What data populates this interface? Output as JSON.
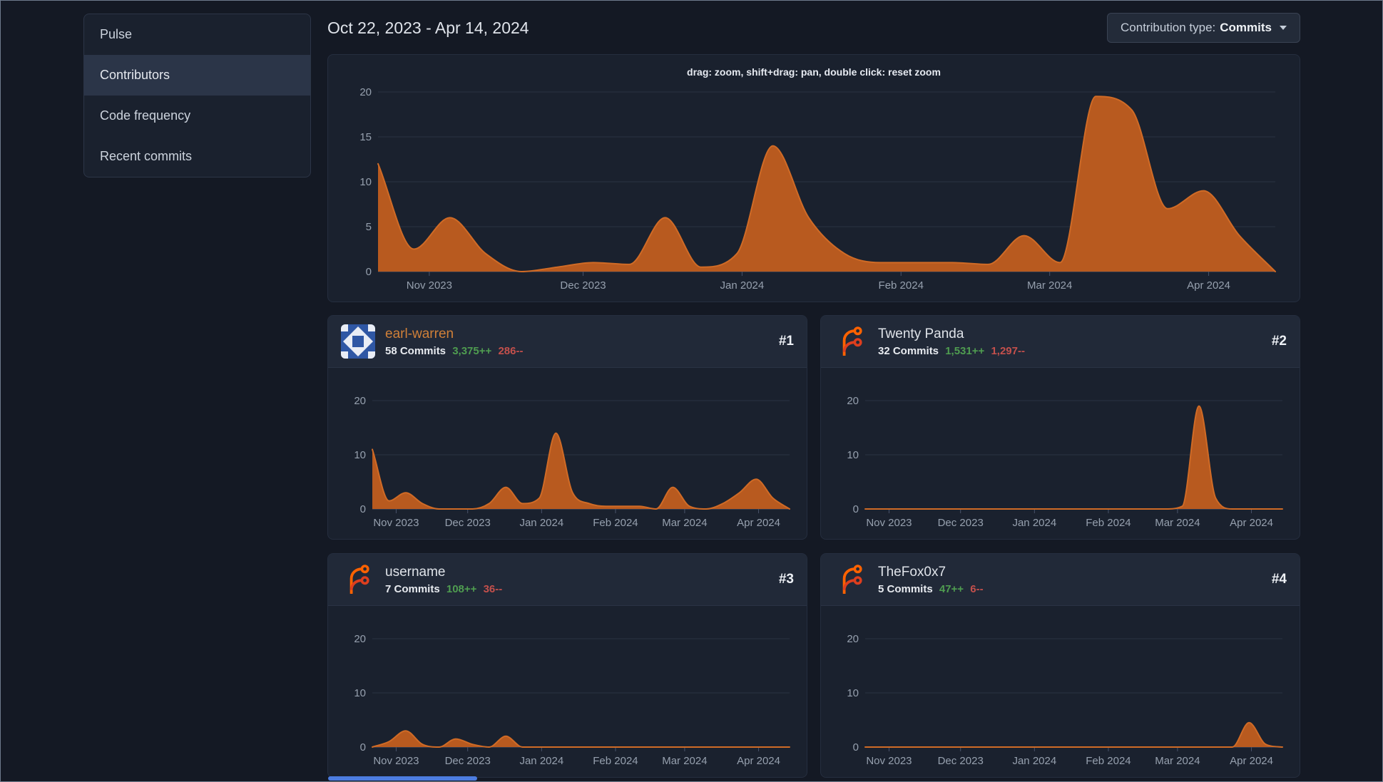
{
  "sidebar": {
    "items": [
      {
        "label": "Pulse",
        "active": false
      },
      {
        "label": "Contributors",
        "active": true
      },
      {
        "label": "Code frequency",
        "active": false
      },
      {
        "label": "Recent commits",
        "active": false
      }
    ]
  },
  "header": {
    "date_range": "Oct 22, 2023 - Apr 14, 2024",
    "contribution_type_label": "Contribution type:",
    "contribution_type_value": "Commits"
  },
  "contributors": [
    {
      "rank": "#1",
      "name": "earl-warren",
      "commits": "58 Commits",
      "additions": "3,375++",
      "deletions": "286--",
      "avatar": "identicon"
    },
    {
      "rank": "#2",
      "name": "Twenty Panda",
      "commits": "32 Commits",
      "additions": "1,531++",
      "deletions": "1,297--",
      "avatar": "forgejo-logo"
    },
    {
      "rank": "#3",
      "name": "username",
      "commits": "7 Commits",
      "additions": "108++",
      "deletions": "36--",
      "avatar": "forgejo-logo"
    },
    {
      "rank": "#4",
      "name": "TheFox0x7",
      "commits": "5 Commits",
      "additions": "47++",
      "deletions": "6--",
      "avatar": "forgejo-logo"
    }
  ],
  "chart_data": [
    {
      "id": "all-contributions",
      "type": "area",
      "size": "main",
      "hint": "drag: zoom, shift+drag: pan, double click: reset zoom",
      "x_range": [
        "Oct 22, 2023",
        "Apr 14, 2024"
      ],
      "interval": "weekly",
      "x_tick_labels": [
        "Nov 2023",
        "Dec 2023",
        "Jan 2024",
        "Feb 2024",
        "Mar 2024",
        "Apr 2024"
      ],
      "x_tick_day_offsets": [
        10,
        40,
        71,
        102,
        131,
        162
      ],
      "total_days": 175,
      "ylim": [
        0,
        20
      ],
      "y_ticks": [
        0,
        5,
        10,
        15,
        20
      ],
      "grid": true,
      "values": [
        12,
        2.5,
        6,
        2,
        0,
        0.5,
        1,
        0.8,
        6,
        0.5,
        2,
        14,
        6,
        2,
        1,
        1,
        1,
        0.8,
        4,
        1,
        19.5,
        18,
        7,
        9,
        4,
        0
      ]
    },
    {
      "id": "earl-warren-commits",
      "type": "area",
      "size": "small",
      "x_range": [
        "Oct 22, 2023",
        "Apr 14, 2024"
      ],
      "interval": "weekly",
      "x_tick_labels": [
        "Nov 2023",
        "Dec 2023",
        "Jan 2024",
        "Feb 2024",
        "Mar 2024",
        "Apr 2024"
      ],
      "x_tick_day_offsets": [
        10,
        40,
        71,
        102,
        131,
        162
      ],
      "total_days": 175,
      "ylim": [
        0,
        20
      ],
      "y_ticks": [
        0,
        10,
        20
      ],
      "grid": true,
      "values": [
        11,
        1.5,
        3,
        1,
        0,
        0,
        0,
        1,
        4,
        1,
        2,
        14,
        3,
        1,
        0.5,
        0.5,
        0.5,
        0,
        4,
        0.5,
        0,
        1,
        3,
        5.5,
        2,
        0
      ]
    },
    {
      "id": "twenty-panda-commits",
      "type": "area",
      "size": "small",
      "x_range": [
        "Oct 22, 2023",
        "Apr 14, 2024"
      ],
      "interval": "weekly",
      "x_tick_labels": [
        "Nov 2023",
        "Dec 2023",
        "Jan 2024",
        "Feb 2024",
        "Mar 2024",
        "Apr 2024"
      ],
      "x_tick_day_offsets": [
        10,
        40,
        71,
        102,
        131,
        162
      ],
      "total_days": 175,
      "ylim": [
        0,
        20
      ],
      "y_ticks": [
        0,
        10,
        20
      ],
      "grid": true,
      "values": [
        0,
        0,
        0,
        0,
        0,
        0,
        0,
        0,
        0,
        0,
        0,
        0,
        0,
        0,
        0,
        0,
        0,
        0,
        0,
        0.5,
        19,
        2,
        0,
        0,
        0,
        0
      ]
    },
    {
      "id": "username-commits",
      "type": "area",
      "size": "small",
      "x_range": [
        "Oct 22, 2023",
        "Apr 14, 2024"
      ],
      "interval": "weekly",
      "x_tick_labels": [
        "Nov 2023",
        "Dec 2023",
        "Jan 2024",
        "Feb 2024",
        "Mar 2024",
        "Apr 2024"
      ],
      "x_tick_day_offsets": [
        10,
        40,
        71,
        102,
        131,
        162
      ],
      "total_days": 175,
      "ylim": [
        0,
        20
      ],
      "y_ticks": [
        0,
        10,
        20
      ],
      "grid": true,
      "values": [
        0,
        1,
        3,
        0.5,
        0,
        1.5,
        0.5,
        0,
        2,
        0,
        0,
        0,
        0,
        0,
        0,
        0,
        0,
        0,
        0,
        0,
        0,
        0,
        0,
        0,
        0,
        0
      ]
    },
    {
      "id": "thefox0x7-commits",
      "type": "area",
      "size": "small",
      "x_range": [
        "Oct 22, 2023",
        "Apr 14, 2024"
      ],
      "interval": "weekly",
      "x_tick_labels": [
        "Nov 2023",
        "Dec 2023",
        "Jan 2024",
        "Feb 2024",
        "Mar 2024",
        "Apr 2024"
      ],
      "x_tick_day_offsets": [
        10,
        40,
        71,
        102,
        131,
        162
      ],
      "total_days": 175,
      "ylim": [
        0,
        20
      ],
      "y_ticks": [
        0,
        10,
        20
      ],
      "grid": true,
      "values": [
        0,
        0,
        0,
        0,
        0,
        0,
        0,
        0,
        0,
        0,
        0,
        0,
        0,
        0,
        0,
        0,
        0,
        0,
        0,
        0,
        0,
        0,
        0,
        4.5,
        0.5,
        0
      ]
    }
  ],
  "colors": {
    "area_fill": "#b85a1f",
    "area_stroke": "#d06b26",
    "additions_green": "#4f9d50",
    "deletions_red": "#c4504c",
    "name_link_orange": "#d08038",
    "forgejo_orange": "#ff6200",
    "forgejo_red": "#dd3e1e",
    "identicon_blue": "#2f57a4",
    "scrollbar_blue": "#4c7ce0"
  }
}
